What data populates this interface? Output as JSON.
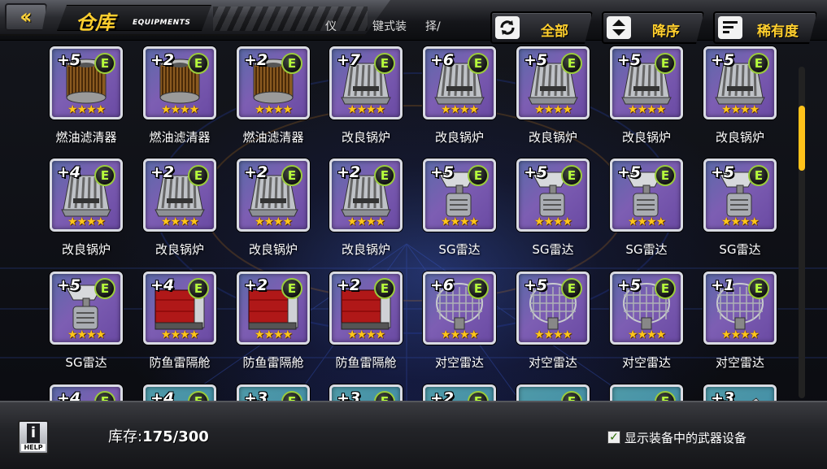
{
  "header": {
    "back_icon": "double-chevron-left-icon",
    "title": "仓库",
    "subtitle": "EQUIPMENTS",
    "crumb_left": "仪",
    "crumb_mid": "键式装",
    "crumb_right": "择/",
    "filter_all_label": "全部",
    "filter_all_icon": "refresh-icon",
    "sort_order_label": "降序",
    "sort_order_icon": "sort-updown-icon",
    "sort_rarity_label": "稀有度",
    "sort_rarity_icon": "list-sort-icon"
  },
  "colors": {
    "accent": "#ffcf2e",
    "card_purple": "#7d5eb3",
    "card_teal": "#3f8aa6",
    "grade_green": "#b6ff3a"
  },
  "items": [
    {
      "level": "+5",
      "grade": "E",
      "stars": "★★★★",
      "name": "燃油滤清器",
      "art": "filter"
    },
    {
      "level": "+2",
      "grade": "E",
      "stars": "★★★★",
      "name": "燃油滤清器",
      "art": "filter"
    },
    {
      "level": "+2",
      "grade": "E",
      "stars": "★★★★",
      "name": "燃油滤清器",
      "art": "filter"
    },
    {
      "level": "+7",
      "grade": "E",
      "stars": "★★★★",
      "name": "改良锅炉",
      "art": "boiler"
    },
    {
      "level": "+6",
      "grade": "E",
      "stars": "★★★★",
      "name": "改良锅炉",
      "art": "boiler"
    },
    {
      "level": "+5",
      "grade": "E",
      "stars": "★★★★",
      "name": "改良锅炉",
      "art": "boiler"
    },
    {
      "level": "+5",
      "grade": "E",
      "stars": "★★★★",
      "name": "改良锅炉",
      "art": "boiler"
    },
    {
      "level": "+5",
      "grade": "E",
      "stars": "★★★★",
      "name": "改良锅炉",
      "art": "boiler"
    },
    {
      "level": "+4",
      "grade": "E",
      "stars": "★★★★",
      "name": "改良锅炉",
      "art": "boiler"
    },
    {
      "level": "+2",
      "grade": "E",
      "stars": "★★★★",
      "name": "改良锅炉",
      "art": "boiler"
    },
    {
      "level": "+2",
      "grade": "E",
      "stars": "★★★★",
      "name": "改良锅炉",
      "art": "boiler"
    },
    {
      "level": "+2",
      "grade": "E",
      "stars": "★★★★",
      "name": "改良锅炉",
      "art": "boiler"
    },
    {
      "level": "+5",
      "grade": "E",
      "stars": "★★★★",
      "name": "SG雷达",
      "art": "radar"
    },
    {
      "level": "+5",
      "grade": "E",
      "stars": "★★★★",
      "name": "SG雷达",
      "art": "radar"
    },
    {
      "level": "+5",
      "grade": "E",
      "stars": "★★★★",
      "name": "SG雷达",
      "art": "radar"
    },
    {
      "level": "+5",
      "grade": "E",
      "stars": "★★★★",
      "name": "SG雷达",
      "art": "radar"
    },
    {
      "level": "+5",
      "grade": "E",
      "stars": "★★★★",
      "name": "SG雷达",
      "art": "radar"
    },
    {
      "level": "+4",
      "grade": "E",
      "stars": "★★★★",
      "name": "防鱼雷隔舱",
      "art": "bulkhead"
    },
    {
      "level": "+2",
      "grade": "E",
      "stars": "★★★★",
      "name": "防鱼雷隔舱",
      "art": "bulkhead"
    },
    {
      "level": "+2",
      "grade": "E",
      "stars": "★★★★",
      "name": "防鱼雷隔舱",
      "art": "bulkhead"
    },
    {
      "level": "+6",
      "grade": "E",
      "stars": "★★★★",
      "name": "对空雷达",
      "art": "dish"
    },
    {
      "level": "+5",
      "grade": "E",
      "stars": "★★★★",
      "name": "对空雷达",
      "art": "dish"
    },
    {
      "level": "+5",
      "grade": "E",
      "stars": "★★★★",
      "name": "对空雷达",
      "art": "dish"
    },
    {
      "level": "+1",
      "grade": "E",
      "stars": "★★★★",
      "name": "对空雷达",
      "art": "dish"
    },
    {
      "level": "+4",
      "grade": "E",
      "stars": "",
      "name": "",
      "art": "none",
      "variant": "purple"
    },
    {
      "level": "+4",
      "grade": "E",
      "stars": "",
      "name": "",
      "art": "gun",
      "variant": "teal"
    },
    {
      "level": "+3",
      "grade": "E",
      "stars": "",
      "name": "",
      "art": "gun",
      "variant": "teal"
    },
    {
      "level": "+3",
      "grade": "E",
      "stars": "",
      "name": "",
      "art": "gun",
      "variant": "teal"
    },
    {
      "level": "+2",
      "grade": "E",
      "stars": "",
      "name": "",
      "art": "gun",
      "variant": "teal"
    },
    {
      "level": "",
      "grade": "E",
      "stars": "",
      "name": "",
      "art": "gun",
      "variant": "teal"
    },
    {
      "level": "",
      "grade": "E",
      "stars": "",
      "name": "",
      "art": "gun",
      "variant": "teal"
    },
    {
      "level": "+3",
      "grade": "",
      "stars": "",
      "name": "",
      "art": "gun",
      "variant": "teal"
    }
  ],
  "footer": {
    "help_label": "HELP",
    "help_icon": "info-icon",
    "stock_label": "库存:",
    "stock_value": "175/300",
    "show_equipped_label": "显示装备中的武器设备",
    "show_equipped_checked": true
  }
}
